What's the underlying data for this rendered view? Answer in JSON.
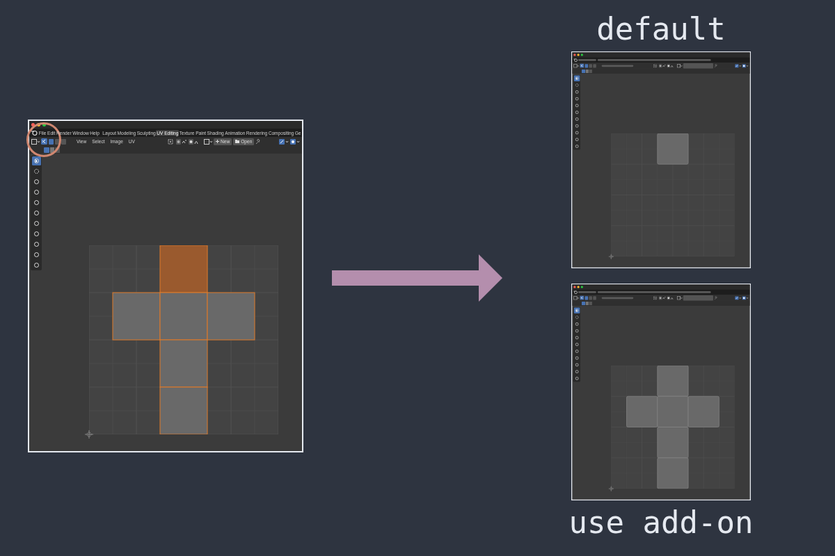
{
  "main_window": {
    "app_menus": [
      "File",
      "Edit",
      "Render",
      "Window",
      "Help"
    ],
    "tabs": [
      {
        "label": "Layout",
        "selected": false
      },
      {
        "label": "Modeling",
        "selected": false
      },
      {
        "label": "Sculpting",
        "selected": false
      },
      {
        "label": "UV Editing",
        "selected": true
      },
      {
        "label": "Texture Paint",
        "selected": false
      },
      {
        "label": "Shading",
        "selected": false
      },
      {
        "label": "Animation",
        "selected": false
      },
      {
        "label": "Rendering",
        "selected": false
      },
      {
        "label": "Compositing",
        "selected": false
      },
      {
        "label": "Ge",
        "selected": false
      }
    ],
    "header_menus": [
      "View",
      "Select",
      "Image",
      "UV"
    ],
    "buttons": [
      {
        "kind": "new",
        "label": "New"
      },
      {
        "kind": "open",
        "label": "Open"
      }
    ],
    "select_modes": [
      {
        "selected": true
      },
      {
        "selected": false
      },
      {
        "selected": false
      }
    ],
    "tools": [
      {
        "selected": true
      },
      {
        "selected": false
      },
      {
        "selected": false
      },
      {
        "selected": false
      },
      {
        "selected": false
      },
      {
        "selected": false
      },
      {
        "selected": false
      },
      {
        "selected": false
      },
      {
        "selected": false
      },
      {
        "selected": false
      },
      {
        "selected": false
      }
    ],
    "edges_highlighted": true,
    "faces": [
      {
        "selected": true
      },
      {
        "selected": false
      },
      {
        "selected": false
      },
      {
        "selected": false
      },
      {
        "selected": false
      },
      {
        "selected": false
      }
    ]
  },
  "results": [
    {
      "caption": "default",
      "window": {
        "select_modes": [
          {
            "selected": true
          },
          {
            "selected": false
          },
          {
            "selected": false
          }
        ],
        "tools": [
          {
            "selected": true
          },
          {
            "selected": false
          },
          {
            "selected": false
          },
          {
            "selected": false
          },
          {
            "selected": false
          },
          {
            "selected": false
          },
          {
            "selected": false
          },
          {
            "selected": false
          },
          {
            "selected": false
          },
          {
            "selected": false
          },
          {
            "selected": false
          }
        ],
        "edges_highlighted": false,
        "faces": [
          {
            "selected": false
          }
        ]
      }
    },
    {
      "caption": "use add-on",
      "window": {
        "select_modes": [
          {
            "selected": true
          },
          {
            "selected": false
          },
          {
            "selected": false
          }
        ],
        "tools": [
          {
            "selected": true
          },
          {
            "selected": false
          },
          {
            "selected": false
          },
          {
            "selected": false
          },
          {
            "selected": false
          },
          {
            "selected": false
          },
          {
            "selected": false
          },
          {
            "selected": false
          },
          {
            "selected": false
          },
          {
            "selected": false
          },
          {
            "selected": false
          }
        ],
        "edges_highlighted": false,
        "faces": [
          {
            "selected": false
          },
          {
            "selected": false
          },
          {
            "selected": false
          },
          {
            "selected": false
          },
          {
            "selected": false
          },
          {
            "selected": false
          }
        ]
      }
    }
  ]
}
